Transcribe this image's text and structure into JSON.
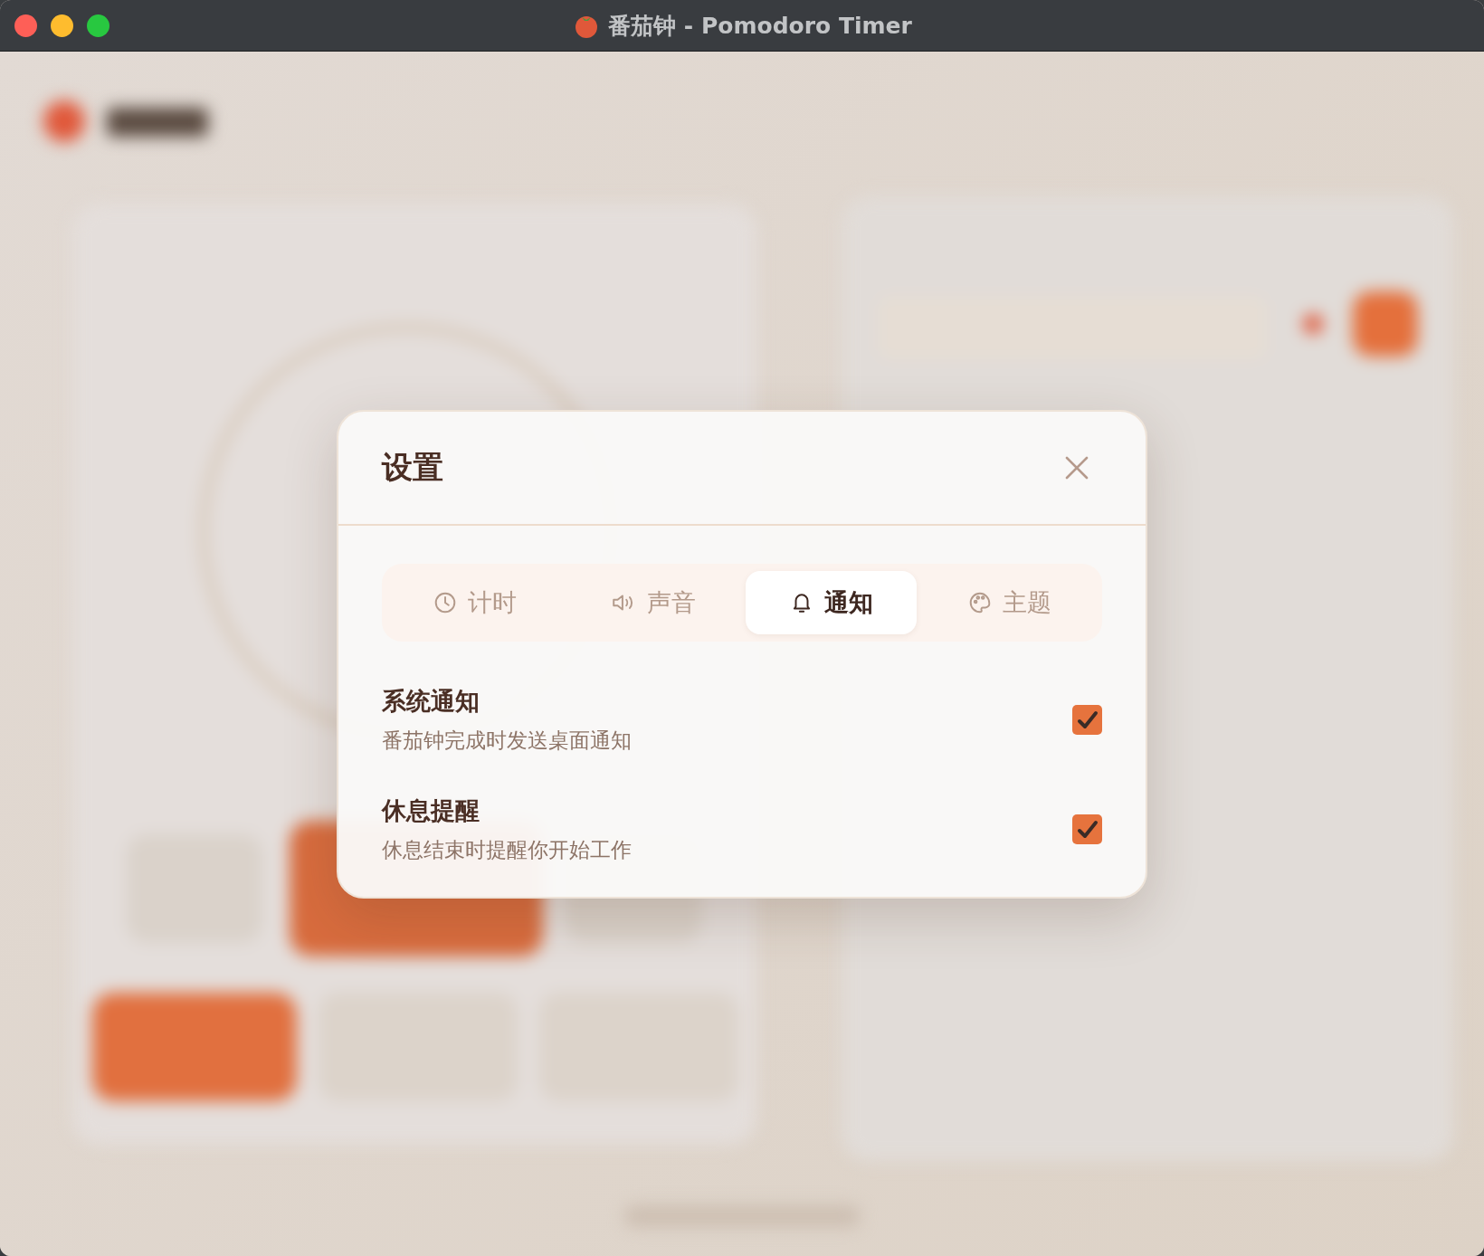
{
  "window": {
    "title": "番茄钟 - Pomodoro Timer"
  },
  "dialog": {
    "title": "设置",
    "tabs": [
      {
        "label": "计时",
        "kind": "clock",
        "selected": false
      },
      {
        "label": "声音",
        "kind": "sound",
        "selected": false
      },
      {
        "label": "通知",
        "kind": "bell",
        "selected": true
      },
      {
        "label": "主题",
        "kind": "palette",
        "selected": false
      }
    ],
    "settings": [
      {
        "title": "系统通知",
        "description": "番茄钟完成时发送桌面通知",
        "checked": true
      },
      {
        "title": "休息提醒",
        "description": "休息结束时提醒你开始工作",
        "checked": true
      }
    ]
  }
}
